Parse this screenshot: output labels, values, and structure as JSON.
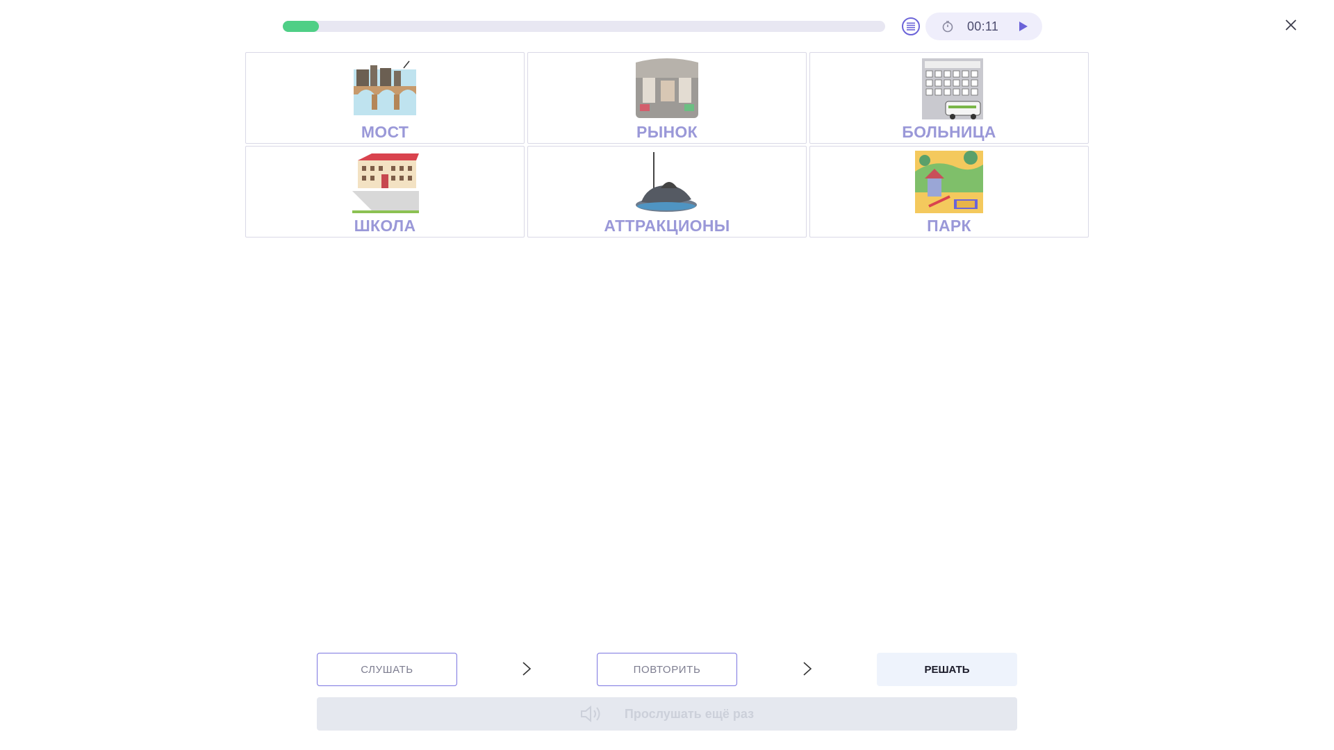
{
  "header": {
    "progress": 0.06,
    "timer": "00:11"
  },
  "cards": [
    {
      "label": "МОСТ",
      "icon": "bridge-picture"
    },
    {
      "label": "РЫНОК",
      "icon": "market-picture"
    },
    {
      "label": "БОЛЬНИЦА",
      "icon": "hospital-picture"
    },
    {
      "label": "ШКОЛА",
      "icon": "school-picture"
    },
    {
      "label": "АТТРАКЦИОНЫ",
      "icon": "bumper-car-picture"
    },
    {
      "label": "ПАРК",
      "icon": "park-picture"
    }
  ],
  "footer": {
    "listen_label": "СЛУШАТЬ",
    "repeat_label": "ПОВТОРИТЬ",
    "solve_label": "РЕШАТЬ",
    "listen_again_label": "Прослушать ещё раз"
  },
  "colors": {
    "accent": "#7b75e0",
    "progress": "#4fcf86",
    "label": "#9a98d8"
  }
}
